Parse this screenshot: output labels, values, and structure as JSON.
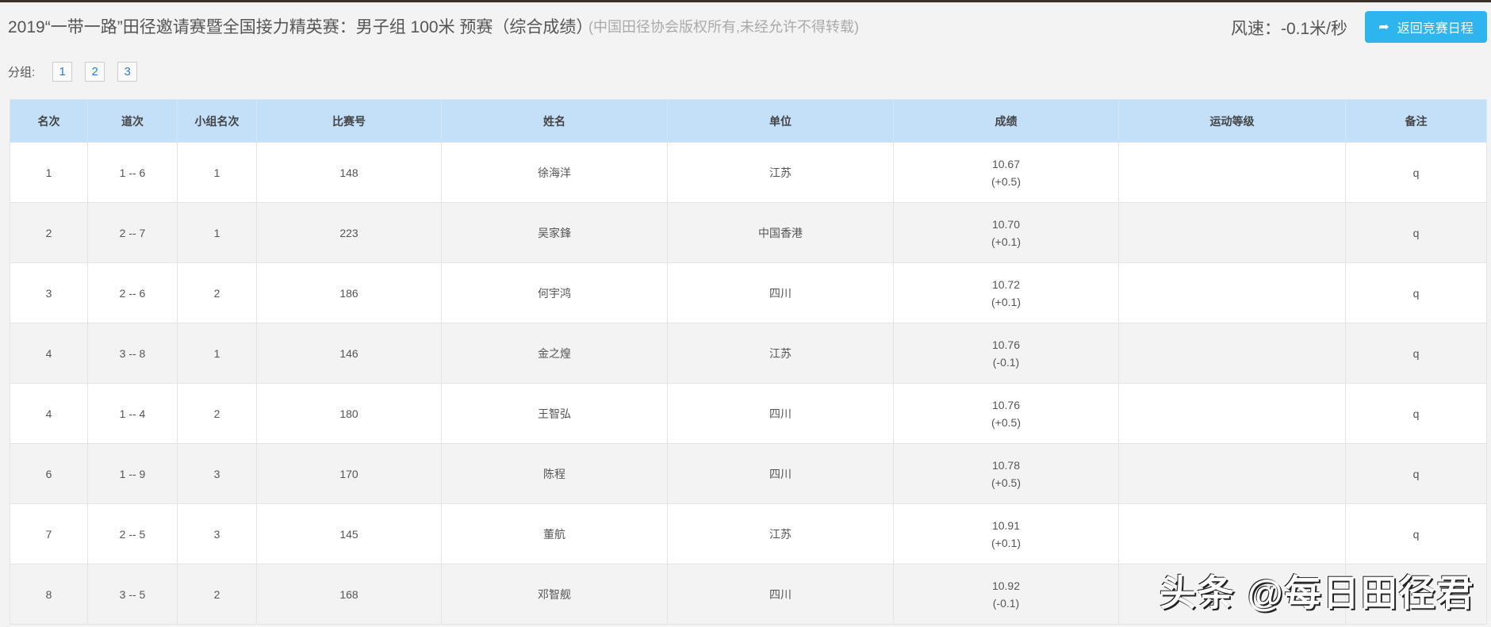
{
  "header": {
    "title": "2019“一带一路”田径邀请赛暨全国接力精英赛：男子组 100米 预赛（综合成绩）",
    "copyright": "(中国田径协会版权所有,未经允许不得转载)",
    "wind": "风速：-0.1米/秒",
    "back_button": "返回竞赛日程"
  },
  "groups": {
    "label": "分组:",
    "items": [
      "1",
      "2",
      "3"
    ]
  },
  "table": {
    "columns": [
      "名次",
      "道次",
      "小组名次",
      "比赛号",
      "姓名",
      "单位",
      "成绩",
      "运动等级",
      "备注"
    ],
    "rows": [
      {
        "rank": "1",
        "lane": "1 -- 6",
        "group_rank": "1",
        "bib": "148",
        "name": "徐海洋",
        "unit": "江苏",
        "result": "10.67",
        "wind": "(+0.5)",
        "level": "",
        "note": "q"
      },
      {
        "rank": "2",
        "lane": "2 -- 7",
        "group_rank": "1",
        "bib": "223",
        "name": "吴家鋒",
        "unit": "中国香港",
        "result": "10.70",
        "wind": "(+0.1)",
        "level": "",
        "note": "q"
      },
      {
        "rank": "3",
        "lane": "2 -- 6",
        "group_rank": "2",
        "bib": "186",
        "name": "何宇鸿",
        "unit": "四川",
        "result": "10.72",
        "wind": "(+0.1)",
        "level": "",
        "note": "q"
      },
      {
        "rank": "4",
        "lane": "3 -- 8",
        "group_rank": "1",
        "bib": "146",
        "name": "金之煌",
        "unit": "江苏",
        "result": "10.76",
        "wind": "(-0.1)",
        "level": "",
        "note": "q"
      },
      {
        "rank": "4",
        "lane": "1 -- 4",
        "group_rank": "2",
        "bib": "180",
        "name": "王智弘",
        "unit": "四川",
        "result": "10.76",
        "wind": "(+0.5)",
        "level": "",
        "note": "q"
      },
      {
        "rank": "6",
        "lane": "1 -- 9",
        "group_rank": "3",
        "bib": "170",
        "name": "陈程",
        "unit": "四川",
        "result": "10.78",
        "wind": "(+0.5)",
        "level": "",
        "note": "q"
      },
      {
        "rank": "7",
        "lane": "2 -- 5",
        "group_rank": "3",
        "bib": "145",
        "name": "董航",
        "unit": "江苏",
        "result": "10.91",
        "wind": "(+0.1)",
        "level": "",
        "note": "q"
      },
      {
        "rank": "8",
        "lane": "3 -- 5",
        "group_rank": "2",
        "bib": "168",
        "name": "邓智舰",
        "unit": "四川",
        "result": "10.92",
        "wind": "(-0.1)",
        "level": "",
        "note": ""
      }
    ]
  },
  "watermark": "头条 @每日田径君"
}
